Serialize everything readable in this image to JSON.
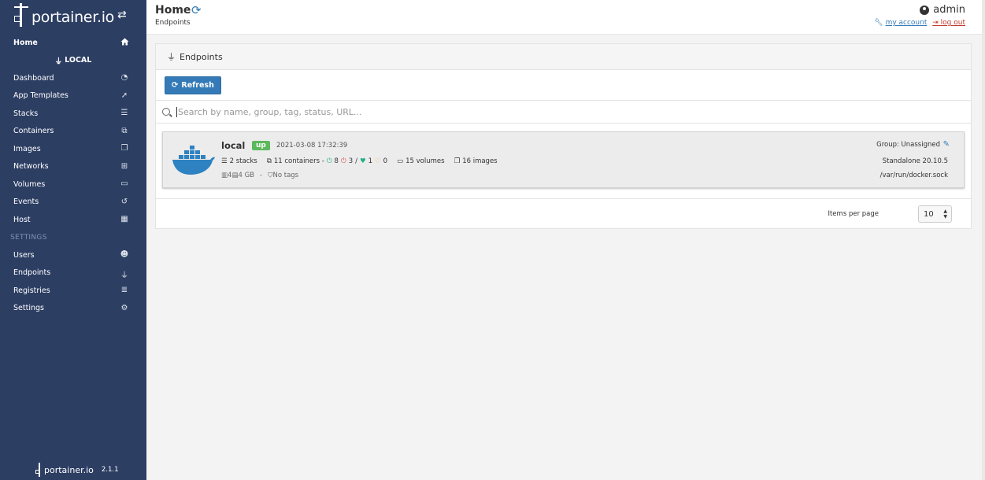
{
  "app": {
    "brand": "portainer.io",
    "version": "2.1.1"
  },
  "sidebar": {
    "home_label": "Home",
    "endpoint_label": "LOCAL",
    "items": [
      {
        "label": "Dashboard",
        "icon": "tachometer-icon"
      },
      {
        "label": "App Templates",
        "icon": "rocket-icon"
      },
      {
        "label": "Stacks",
        "icon": "list-icon"
      },
      {
        "label": "Containers",
        "icon": "cubes-icon"
      },
      {
        "label": "Images",
        "icon": "clone-icon"
      },
      {
        "label": "Networks",
        "icon": "sitemap-icon"
      },
      {
        "label": "Volumes",
        "icon": "hdd-icon"
      },
      {
        "label": "Events",
        "icon": "history-icon"
      },
      {
        "label": "Host",
        "icon": "th-icon"
      }
    ],
    "settings_heading": "SETTINGS",
    "settings_items": [
      {
        "label": "Users",
        "icon": "users-icon"
      },
      {
        "label": "Endpoints",
        "icon": "plug-icon"
      },
      {
        "label": "Registries",
        "icon": "database-icon"
      },
      {
        "label": "Settings",
        "icon": "cogs-icon"
      }
    ]
  },
  "header": {
    "title": "Home",
    "breadcrumb": "Endpoints",
    "username": "admin",
    "my_account": "my account",
    "log_out": "log out"
  },
  "panel": {
    "heading": "Endpoints",
    "refresh_label": "Refresh",
    "search_placeholder": "Search by name, group, tag, status, URL..."
  },
  "endpoint": {
    "name": "local",
    "status": "up",
    "datetime": "2021-03-08 17:32:39",
    "stacks": "2 stacks",
    "containers": "11 containers -",
    "running": "8",
    "stopped": "3",
    "separator": "/",
    "healthy": "1",
    "unhealthy": "0",
    "volumes": "15 volumes",
    "images": "16 images",
    "cpu": "4",
    "memory": "4 GB",
    "dash": "-",
    "tags": "No tags",
    "group": "Group: Unassigned",
    "type": "Standalone 20.10.5",
    "url": "/var/run/docker.sock"
  },
  "pagination": {
    "items_per_page_label": "Items per page",
    "items_per_page_value": "10"
  },
  "colors": {
    "sidebar": "#2d3e63",
    "primary": "#337ab7",
    "success": "#5cb85c",
    "danger": "#d9534f",
    "docker_blue": "#2f82c1"
  }
}
